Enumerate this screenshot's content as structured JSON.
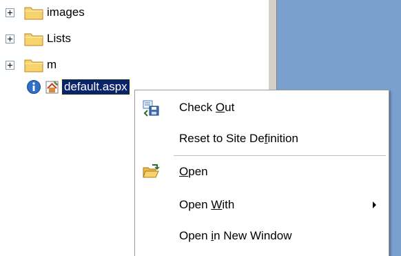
{
  "colors": {
    "selection_bg": "#0a246a",
    "blue_pane": "#7aa0cf",
    "splitter": "#d4d0c8"
  },
  "tree": {
    "folders": [
      {
        "label": "images",
        "icon": "folder-icon"
      },
      {
        "label": "Lists",
        "icon": "folder-icon"
      },
      {
        "label": "m",
        "icon": "folder-icon"
      }
    ],
    "file": {
      "label": "default.aspx",
      "icons": [
        "info-icon",
        "home-page-icon"
      ]
    }
  },
  "context_menu": {
    "items": [
      {
        "pre": "Check ",
        "accel": "O",
        "post": "ut",
        "icon": "check-out-icon"
      },
      {
        "pre": "Reset to Site De",
        "accel": "f",
        "post": "inition",
        "icon": ""
      },
      {
        "pre": "",
        "accel": "O",
        "post": "pen",
        "icon": "open-folder-icon"
      },
      {
        "pre": "Open ",
        "accel": "W",
        "post": "ith",
        "icon": "",
        "submenu": true
      },
      {
        "pre": "Open ",
        "accel": "i",
        "post": "n New Window",
        "icon": ""
      }
    ]
  }
}
